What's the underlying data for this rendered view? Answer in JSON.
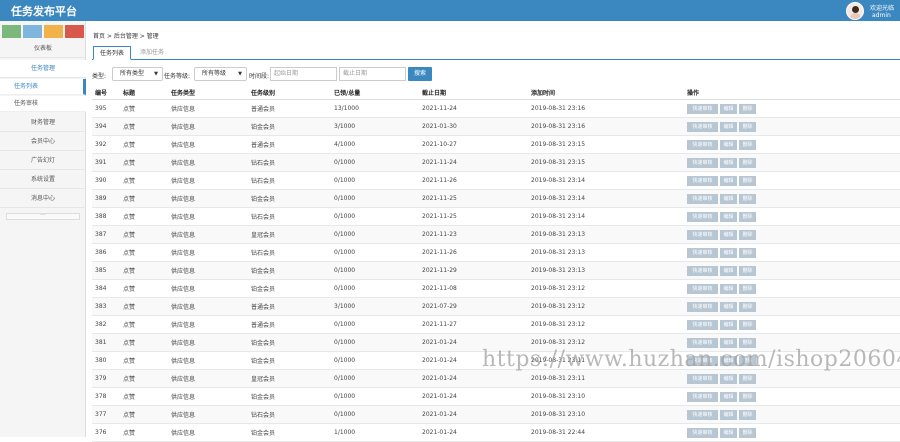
{
  "app": {
    "title": "任务发布平台"
  },
  "user": {
    "welcome": "欢迎光临",
    "name": "admin"
  },
  "sidebar": {
    "swatches": [
      "#7cb87c",
      "#7eb6dd",
      "#f2b14a",
      "#d8584c"
    ],
    "items": [
      "仪表板",
      "任务管理",
      "财务管理",
      "会员中心",
      "广告幻灯",
      "系统设置",
      "消息中心"
    ],
    "subitems": [
      "任务列表",
      "任务审核"
    ]
  },
  "breadcrumb": "首页 > 后台管理 > 管理",
  "tabs": [
    "任务列表",
    "添加任务"
  ],
  "filter": {
    "type_label": "类型:",
    "type_value": "所有类型",
    "level_label": "任务等级:",
    "level_value": "所有等级",
    "time_label": "时间段:",
    "start_placeholder": "起始日期",
    "end_placeholder": "截止日期",
    "search_label": "搜索"
  },
  "table": {
    "headers": [
      "编号",
      "标题",
      "任务类型",
      "任务级别",
      "已领/总量",
      "截止日期",
      "添加时间",
      "操作"
    ],
    "actions": [
      "快速审核",
      "编辑",
      "删除"
    ],
    "rows": [
      [
        "395",
        "点赞",
        "供应信息",
        "普通会员",
        "13/1000",
        "2021-11-24",
        "2019-08-31 23:16"
      ],
      [
        "394",
        "点赞",
        "供应信息",
        "铂金会员",
        "3/1000",
        "2021-01-30",
        "2019-08-31 23:16"
      ],
      [
        "392",
        "点赞",
        "供应信息",
        "普通会员",
        "4/1000",
        "2021-10-27",
        "2019-08-31 23:15"
      ],
      [
        "391",
        "点赞",
        "供应信息",
        "钻石会员",
        "0/1000",
        "2021-11-24",
        "2019-08-31 23:15"
      ],
      [
        "390",
        "点赞",
        "供应信息",
        "钻石会员",
        "0/1000",
        "2021-11-26",
        "2019-08-31 23:14"
      ],
      [
        "389",
        "点赞",
        "供应信息",
        "铂金会员",
        "0/1000",
        "2021-11-25",
        "2019-08-31 23:14"
      ],
      [
        "388",
        "点赞",
        "供应信息",
        "钻石会员",
        "0/1000",
        "2021-11-25",
        "2019-08-31 23:14"
      ],
      [
        "387",
        "点赞",
        "供应信息",
        "皇冠会员",
        "0/1000",
        "2021-11-23",
        "2019-08-31 23:13"
      ],
      [
        "386",
        "点赞",
        "供应信息",
        "钻石会员",
        "0/1000",
        "2021-11-26",
        "2019-08-31 23:13"
      ],
      [
        "385",
        "点赞",
        "供应信息",
        "铂金会员",
        "0/1000",
        "2021-11-29",
        "2019-08-31 23:13"
      ],
      [
        "384",
        "点赞",
        "供应信息",
        "铂金会员",
        "0/1000",
        "2021-11-08",
        "2019-08-31 23:12"
      ],
      [
        "383",
        "点赞",
        "供应信息",
        "普通会员",
        "3/1000",
        "2021-07-29",
        "2019-08-31 23:12"
      ],
      [
        "382",
        "点赞",
        "供应信息",
        "普通会员",
        "0/1000",
        "2021-11-27",
        "2019-08-31 23:12"
      ],
      [
        "381",
        "点赞",
        "供应信息",
        "铂金会员",
        "0/1000",
        "2021-01-24",
        "2019-08-31 23:12"
      ],
      [
        "380",
        "点赞",
        "供应信息",
        "铂金会员",
        "0/1000",
        "2021-01-24",
        "2019-08-31 23:11"
      ],
      [
        "379",
        "点赞",
        "供应信息",
        "皇冠会员",
        "0/1000",
        "2021-01-24",
        "2019-08-31 23:11"
      ],
      [
        "378",
        "点赞",
        "供应信息",
        "铂金会员",
        "0/1000",
        "2021-01-24",
        "2019-08-31 23:10"
      ],
      [
        "377",
        "点赞",
        "供应信息",
        "钻石会员",
        "0/1000",
        "2021-01-24",
        "2019-08-31 23:10"
      ],
      [
        "376",
        "点赞",
        "供应信息",
        "铂金会员",
        "1/1000",
        "2021-01-24",
        "2019-08-31 22:44"
      ]
    ]
  },
  "watermark": "https://www.huzhan.com/ishop20604"
}
